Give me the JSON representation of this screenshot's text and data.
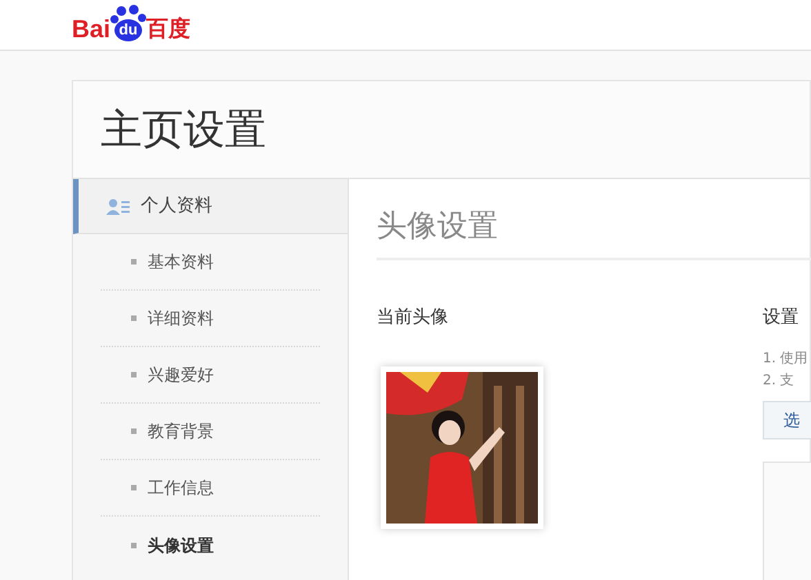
{
  "logo": {
    "left": "Bai",
    "paw": "du",
    "right": "百度"
  },
  "page": {
    "title": "主页设置"
  },
  "sidebar": {
    "section": {
      "label": "个人资料",
      "selected": true
    },
    "items": [
      {
        "label": "基本资料",
        "selected": false
      },
      {
        "label": "详细资料",
        "selected": false
      },
      {
        "label": "兴趣爱好",
        "selected": false
      },
      {
        "label": "教育背景",
        "selected": false
      },
      {
        "label": "工作信息",
        "selected": false
      },
      {
        "label": "头像设置",
        "selected": true
      }
    ]
  },
  "content": {
    "title": "头像设置",
    "current_label": "当前头像",
    "new_label": "设置",
    "tips": [
      "1. 使用",
      "2. 支"
    ],
    "choose_button": "选"
  }
}
